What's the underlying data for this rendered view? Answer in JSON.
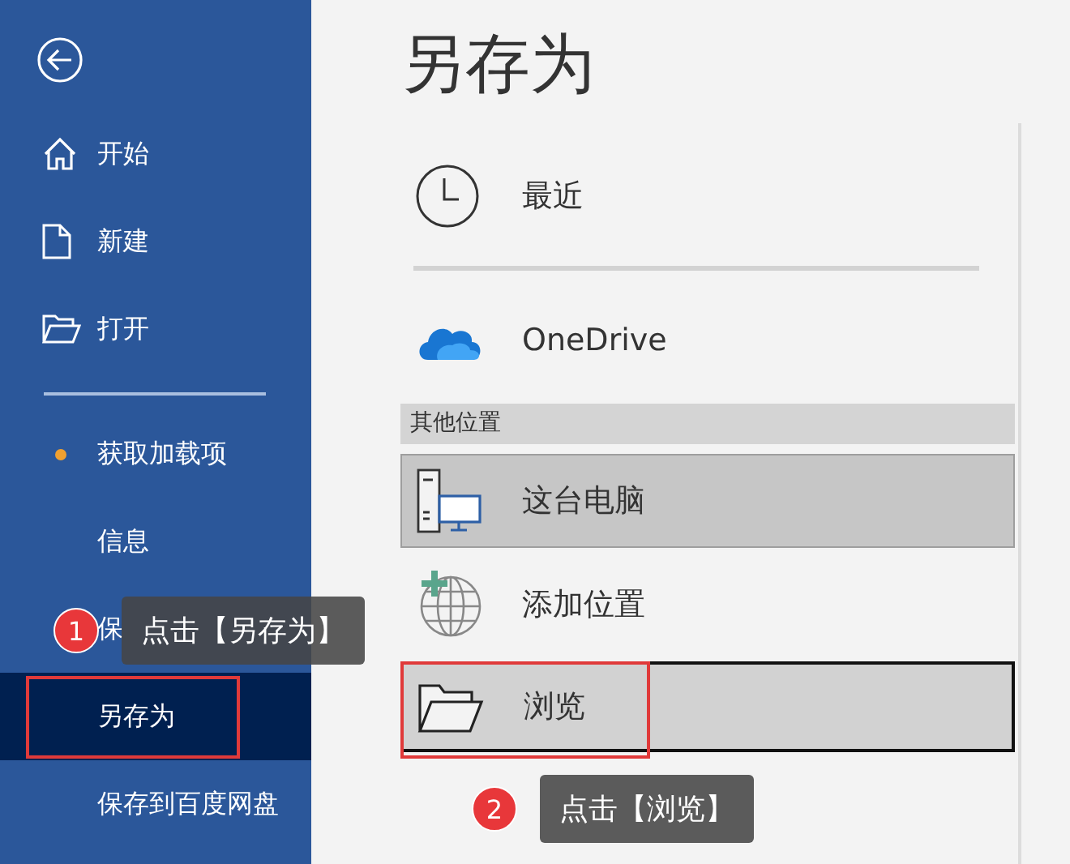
{
  "sidebar": {
    "items": [
      {
        "kind": "home",
        "label": "开始",
        "selected": false,
        "marked": false
      },
      {
        "kind": "file",
        "label": "新建",
        "selected": false,
        "marked": false
      },
      {
        "kind": "folder",
        "label": "打开",
        "selected": false,
        "marked": false
      },
      {
        "kind": "divider"
      },
      {
        "kind": "dot",
        "label": "获取加载项",
        "selected": false,
        "marked": false
      },
      {
        "kind": "plain",
        "label": "信息",
        "selected": false,
        "marked": false
      },
      {
        "kind": "plain",
        "label": "保",
        "selected": false,
        "marked": false
      },
      {
        "kind": "plain",
        "label": "另存为",
        "selected": true,
        "marked": true
      },
      {
        "kind": "plain",
        "label": "保存到百度网盘",
        "selected": false,
        "marked": false
      }
    ]
  },
  "title": "另存为",
  "places": [
    {
      "kind": "clock",
      "label": "最近",
      "selected": false,
      "focused": false,
      "marked": false
    },
    {
      "kind": "divider"
    },
    {
      "kind": "cloud",
      "label": "OneDrive",
      "selected": false,
      "focused": false,
      "marked": false
    },
    {
      "kind": "header",
      "label": "其他位置"
    },
    {
      "kind": "computer",
      "label": "这台电脑",
      "selected": true,
      "focused": false,
      "marked": false
    },
    {
      "kind": "globe",
      "label": "添加位置",
      "selected": false,
      "focused": false,
      "marked": false
    },
    {
      "kind": "folder",
      "label": "浏览",
      "selected": false,
      "focused": true,
      "marked": true
    }
  ],
  "annotations": [
    {
      "number": "1",
      "text": "点击【另存为】"
    },
    {
      "number": "2",
      "text": "点击【浏览】"
    }
  ]
}
